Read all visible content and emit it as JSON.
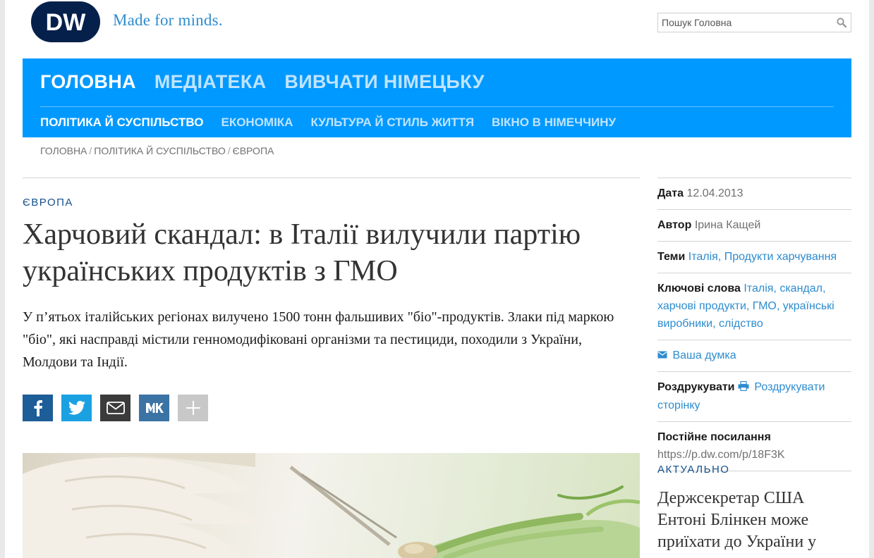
{
  "header": {
    "logo_text": "DW",
    "tagline": "Made for minds.",
    "search_placeholder": "Пошук Головна"
  },
  "nav": {
    "main": [
      {
        "label": "ГОЛОВНА",
        "active": true
      },
      {
        "label": "МЕДІАТЕКА",
        "active": false
      },
      {
        "label": "ВИВЧАТИ НІМЕЦЬКУ",
        "active": false
      }
    ],
    "sub": [
      {
        "label": "ПОЛІТИКА Й СУСПІЛЬСТВО",
        "active": true
      },
      {
        "label": "ЕКОНОМІКА",
        "active": false
      },
      {
        "label": "КУЛЬТУРА Й СТИЛЬ ЖИТТЯ",
        "active": false
      },
      {
        "label": "ВІКНО В НІМЕЧЧИНУ",
        "active": false
      }
    ]
  },
  "breadcrumb": [
    "ГОЛОВНА",
    "ПОЛІТИКА Й СУСПІЛЬСТВО",
    "ЄВРОПА"
  ],
  "article": {
    "kicker": "ЄВРОПА",
    "headline": "Харчовий скандал: в Італії вилучили партію українських продуктів з ГМО",
    "teaser": "У п’ятьох італійських регіонах вилучено 1500 тонн фальшивих \"біо\"-продуктів. Злаки під маркою \"біо\", які насправді містили генномодифіковані організми та пестициди, походили з України, Молдови та Індії.",
    "share": [
      {
        "name": "facebook-icon",
        "glyph": "f"
      },
      {
        "name": "twitter-icon",
        "glyph": "t"
      },
      {
        "name": "email-icon",
        "glyph": "mail"
      },
      {
        "name": "vk-icon",
        "glyph": "vk"
      },
      {
        "name": "more-icon",
        "glyph": "+"
      }
    ]
  },
  "sidebar": {
    "date_label": "Дата",
    "date_value": "12.04.2013",
    "author_label": "Автор",
    "author_value": "Ірина Кащей",
    "topics_label": "Теми",
    "topics_value": "Італія, Продукти харчування",
    "keywords_label": "Ключові слова",
    "keywords_value": "Італія, скандал, харчові продукти, ГМО, українські виробники, слідство",
    "feedback_link": "Ваша думка",
    "print_label": "Роздрукувати",
    "print_link": "Роздрукувати сторінку",
    "permalink_label": "Постійне посилання",
    "permalink_value": "https://p.dw.com/p/18F3K",
    "actual_label": "АКТУАЛЬНО",
    "actual_title": "Держсекретар США Ентоні Блінкен може приїхати до України у"
  },
  "colors": {
    "nav_blue": "#0099ff",
    "link_blue": "#2d8ccf",
    "kicker_blue": "#14508c",
    "dw_navy": "#05204b"
  }
}
